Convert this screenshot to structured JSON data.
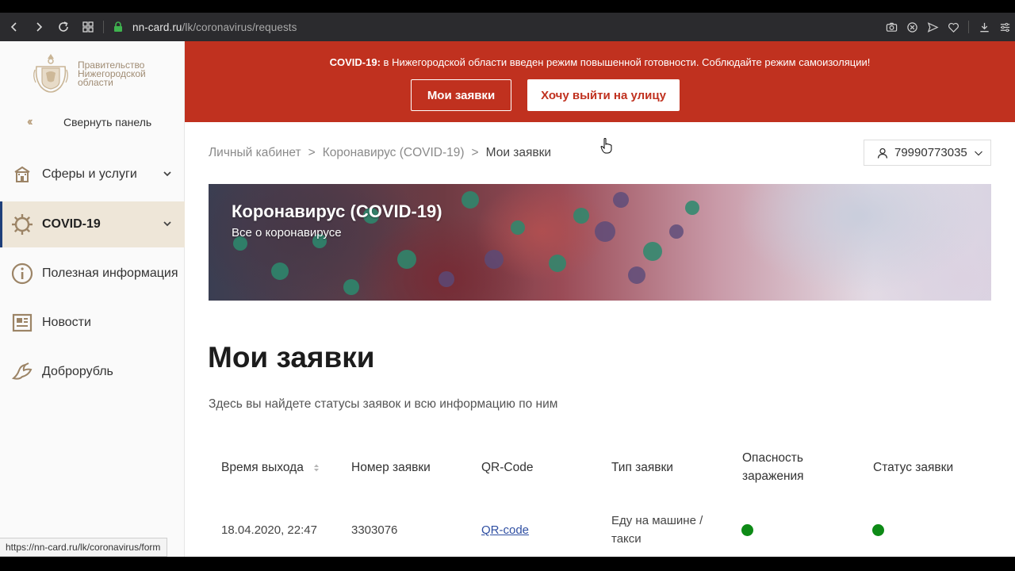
{
  "browser": {
    "url_host": "nn-card.ru",
    "url_path": "/lk/coronavirus/requests"
  },
  "sidebar": {
    "logo_text": [
      "Правительство",
      "Нижегородской",
      "области"
    ],
    "collapse_label": "Свернуть панель",
    "items": [
      {
        "label": "Сферы и услуги",
        "icon": "building-icon"
      },
      {
        "label": "COVID-19",
        "icon": "virus-icon"
      },
      {
        "label": "Полезная информация",
        "icon": "info-icon"
      },
      {
        "label": "Новости",
        "icon": "news-icon"
      },
      {
        "label": "Доброрубль",
        "icon": "dove-icon"
      }
    ]
  },
  "status_bar": {
    "hover_url": "https://nn-card.ru/lk/coronavirus/form"
  },
  "banner": {
    "prefix": "COVID-19:",
    "text": " в Нижегородской области введен режим повышенной готовности. Соблюдайте режим самоизоляции!",
    "btn_requests": "Мои заявки",
    "btn_go_out": "Хочу выйти на улицу"
  },
  "breadcrumbs": {
    "items": [
      "Личный кабинет",
      "Коронавирус (COVID-19)",
      "Мои заявки"
    ],
    "separator": ">"
  },
  "user": {
    "phone": "79990773035"
  },
  "hero": {
    "title": "Коронавирус (COVID-19)",
    "subtitle": "Все о коронавирусе"
  },
  "main": {
    "title": "Мои заявки",
    "description": "Здесь вы найдете статусы заявок и всю информацию по ним"
  },
  "table": {
    "headers": [
      "Время выхода",
      "Номер заявки",
      "QR-Code",
      "Тип заявки",
      "Опасность заражения",
      "Статус заявки"
    ],
    "header_lines": {
      "danger_1": "Опасность",
      "danger_2": "заражения"
    },
    "rows": [
      {
        "time": "18.04.2020, 22:47",
        "number": "3303076",
        "qr": "QR-code",
        "type_1": "Еду на машине /",
        "type_2": "такси",
        "danger_color": "#0d8a16",
        "status_color": "#0d8a16"
      }
    ]
  },
  "colors": {
    "banner_red": "#c0311f",
    "accent_gold": "#b9a07e",
    "active_bg": "#eee6d8",
    "active_border": "#1f3f7a",
    "status_green": "#0d8a16"
  }
}
